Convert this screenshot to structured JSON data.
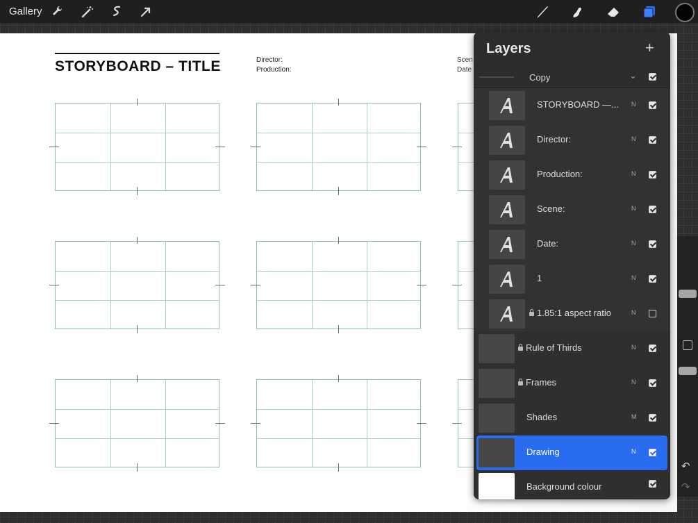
{
  "toolbar": {
    "gallery_label": "Gallery",
    "left_tools": [
      "wrench-icon",
      "magic-wand-icon",
      "selection-icon",
      "transform-icon"
    ],
    "right_tools": [
      "brush-icon",
      "smudge-icon",
      "eraser-icon",
      "layers-icon"
    ],
    "active_color": "#050505",
    "accent_color": "#2a6cf0"
  },
  "canvas": {
    "title": "STORYBOARD – TITLE",
    "director_label": "Director:",
    "production_label": "Production:",
    "scene_label": "Scen",
    "date_label": "Date"
  },
  "layers_panel": {
    "title": "Layers",
    "add_label": "+",
    "group": {
      "name": "Copy",
      "chevron": "⌄",
      "visible": true
    },
    "items": [
      {
        "name": "STORYBOARD —...",
        "blend": "N",
        "visible": true,
        "type": "text",
        "locked": false
      },
      {
        "name": "Director:",
        "blend": "N",
        "visible": true,
        "type": "text",
        "locked": false
      },
      {
        "name": "Production:",
        "blend": "N",
        "visible": true,
        "type": "text",
        "locked": false
      },
      {
        "name": "Scene:",
        "blend": "N",
        "visible": true,
        "type": "text",
        "locked": false
      },
      {
        "name": "Date:",
        "blend": "N",
        "visible": true,
        "type": "text",
        "locked": false
      },
      {
        "name": "1",
        "blend": "N",
        "visible": true,
        "type": "text",
        "locked": false
      },
      {
        "name": "1.85:1 aspect ratio",
        "blend": "N",
        "visible": false,
        "type": "text",
        "locked": true
      },
      {
        "name": "Rule of Thirds",
        "blend": "N",
        "visible": true,
        "type": "image",
        "locked": true
      },
      {
        "name": "Frames",
        "blend": "N",
        "visible": true,
        "type": "image",
        "locked": true
      },
      {
        "name": "Shades",
        "blend": "M",
        "visible": true,
        "type": "image",
        "locked": false
      },
      {
        "name": "Drawing",
        "blend": "N",
        "visible": true,
        "type": "image",
        "locked": false,
        "selected": true
      },
      {
        "name": "Background colour",
        "blend": "",
        "visible": true,
        "type": "background",
        "locked": false
      }
    ]
  },
  "sidebar": {
    "undo_label": "↶",
    "redo_label": "↷"
  }
}
